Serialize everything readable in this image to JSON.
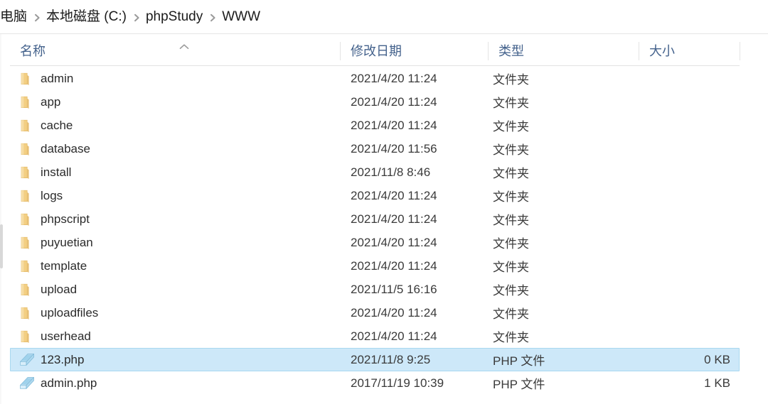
{
  "window": {
    "title": "WWW"
  },
  "address_bar": {
    "crumbs": [
      {
        "label": "电脑",
        "name": "breadcrumb-this-pc"
      },
      {
        "label": "本地磁盘 (C:)",
        "name": "breadcrumb-local-disk-c"
      },
      {
        "label": "phpStudy",
        "name": "breadcrumb-phpstudy"
      },
      {
        "label": "WWW",
        "name": "breadcrumb-www"
      }
    ]
  },
  "columns": {
    "name": "名称",
    "date_modified": "修改日期",
    "type": "类型",
    "size": "大小",
    "sort_column": "名称",
    "sort_direction": "ascending"
  },
  "files": [
    {
      "name": "admin",
      "date": "2021/4/20 11:24",
      "type": "文件夹",
      "size": "",
      "icon": "folder-icon",
      "selected": false
    },
    {
      "name": "app",
      "date": "2021/4/20 11:24",
      "type": "文件夹",
      "size": "",
      "icon": "folder-icon",
      "selected": false
    },
    {
      "name": "cache",
      "date": "2021/4/20 11:24",
      "type": "文件夹",
      "size": "",
      "icon": "folder-icon",
      "selected": false
    },
    {
      "name": "database",
      "date": "2021/4/20 11:56",
      "type": "文件夹",
      "size": "",
      "icon": "folder-icon",
      "selected": false
    },
    {
      "name": "install",
      "date": "2021/11/8 8:46",
      "type": "文件夹",
      "size": "",
      "icon": "folder-icon",
      "selected": false
    },
    {
      "name": "logs",
      "date": "2021/4/20 11:24",
      "type": "文件夹",
      "size": "",
      "icon": "folder-icon",
      "selected": false
    },
    {
      "name": "phpscript",
      "date": "2021/4/20 11:24",
      "type": "文件夹",
      "size": "",
      "icon": "folder-icon",
      "selected": false
    },
    {
      "name": "puyuetian",
      "date": "2021/4/20 11:24",
      "type": "文件夹",
      "size": "",
      "icon": "folder-icon",
      "selected": false
    },
    {
      "name": "template",
      "date": "2021/4/20 11:24",
      "type": "文件夹",
      "size": "",
      "icon": "folder-icon",
      "selected": false
    },
    {
      "name": "upload",
      "date": "2021/11/5 16:16",
      "type": "文件夹",
      "size": "",
      "icon": "folder-icon",
      "selected": false
    },
    {
      "name": "uploadfiles",
      "date": "2021/4/20 11:24",
      "type": "文件夹",
      "size": "",
      "icon": "folder-icon",
      "selected": false
    },
    {
      "name": "userhead",
      "date": "2021/4/20 11:24",
      "type": "文件夹",
      "size": "",
      "icon": "folder-icon",
      "selected": false
    },
    {
      "name": "123.php",
      "date": "2021/11/8 9:25",
      "type": "PHP 文件",
      "size": "0 KB",
      "icon": "php-file-icon",
      "selected": true
    },
    {
      "name": "admin.php",
      "date": "2017/11/19 10:39",
      "type": "PHP 文件",
      "size": "1 KB",
      "icon": "php-file-icon",
      "selected": false
    }
  ],
  "colors": {
    "selection_fill": "#cde8f9",
    "selection_border": "#a8d8f0",
    "header_text": "#44628c",
    "folder_icon": "#f6d68a",
    "php_icon": "#9fd2ec"
  }
}
